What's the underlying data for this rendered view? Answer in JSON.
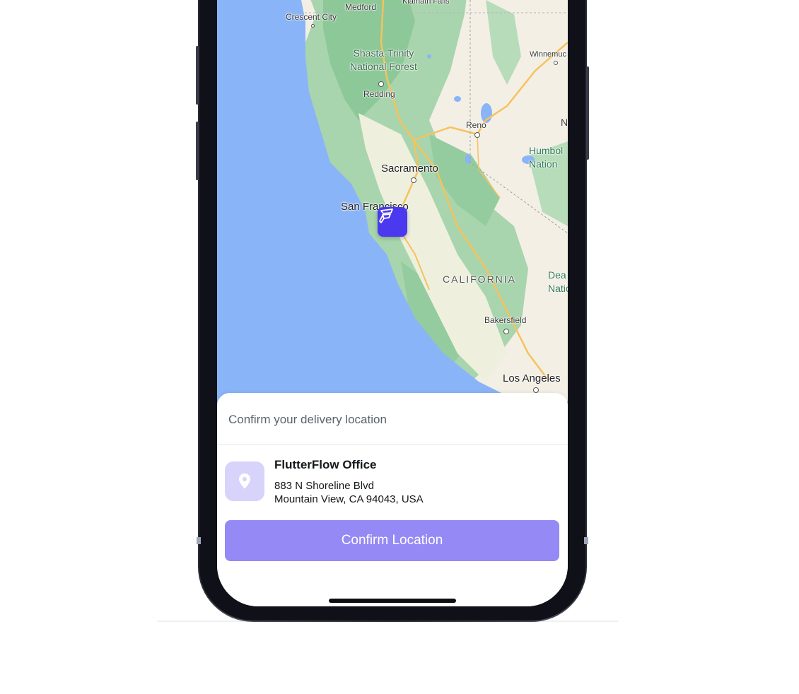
{
  "map": {
    "labels": {
      "medford": "Medford",
      "klamath_falls": "Klamath Falls",
      "crescent_city": "Crescent City",
      "shasta_trinity": "Shasta-Trinity\nNational Forest",
      "redding": "Redding",
      "winnemucca": "Winnemuc",
      "reno": "Reno",
      "n_partial": "N",
      "humboldt": "Humbol\nNation",
      "sacramento": "Sacramento",
      "san_francisco": "San Francisco",
      "california": "CALIFORNIA",
      "death_valley": "Dea\nNatio",
      "bakersfield": "Bakersfield",
      "los_angeles": "Los Angeles"
    },
    "marker_icon": "flutterflow-logo-icon"
  },
  "sheet": {
    "header": "Confirm your delivery location",
    "location": {
      "icon": "location-pin-icon",
      "title": "FlutterFlow Office",
      "address_line1": "883 N Shoreline Blvd",
      "address_line2": "Mountain View, CA 94043, USA"
    },
    "confirm_label": "Confirm Location"
  },
  "colors": {
    "accent": "#4b39ef",
    "button": "#9489f5",
    "icon_bg": "#d8d3fb",
    "ocean": "#8ab4f8",
    "land": "#f3efe5",
    "forest": "#9ccfa6"
  }
}
